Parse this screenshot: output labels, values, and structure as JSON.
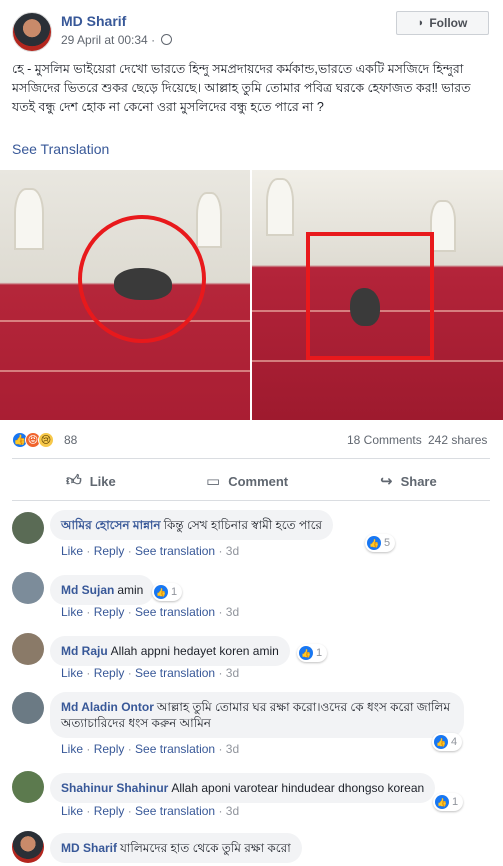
{
  "post": {
    "author": "MD Sharif",
    "timestamp": "29 April at 00:34 · ",
    "follow_label": "Follow",
    "text": "হে - মুসলিম ভাইয়েরা দেখো ভারতে হিন্দু সমপ্রদায়দের কর্মকান্ড,ভারতে একটি মসজিদে হিন্দুরা মসজিদের ভিতরে শুকর ছেড়ে দিয়েছে। আল্লাহ তুমি তোমার পবিত্র ঘরকে হেফাজত কর‼ ভারত যতই বন্ধু দেশ হোক না কেনো ওরা মুসলিদের বন্ধু হতে পারে না ?",
    "see_translation": "See Translation"
  },
  "stats": {
    "reaction_count": "88",
    "comments": "18 Comments",
    "shares": "242 shares"
  },
  "actions": {
    "like": "Like",
    "comment": "Comment",
    "share": "Share"
  },
  "icons": {
    "follow": "rss-icon",
    "like": "thumbs-up-icon",
    "comment": "speech-bubble-icon",
    "share": "share-arrow-icon",
    "privacy": "globe-icon"
  },
  "colors": {
    "link": "#385898",
    "like_blue": "#1877f2",
    "annotation_red": "#e8191c"
  },
  "comments": [
    {
      "name": "আমির হোসেন মান্নান",
      "text": "কিন্তু সেখ হাচিনার স্বামী হতে পারে",
      "like": "Like",
      "reply": "Reply",
      "translation": "See translation",
      "age": "3d",
      "likes": "5"
    },
    {
      "name": "Md Sujan",
      "text": "amin",
      "like": "Like",
      "reply": "Reply",
      "translation": "See translation",
      "age": "3d",
      "likes": "1"
    },
    {
      "name": "Md Raju",
      "text": "Allah appni hedayet koren amin",
      "like": "Like",
      "reply": "Reply",
      "translation": "See translation",
      "age": "3d",
      "likes": "1"
    },
    {
      "name": "Md Aladin Ontor",
      "text": "আল্লাহ তুমি তোমার ঘর রক্ষা করো।ওদের কে ধংস করো জালিম অত্যাচারিদের ধংস করুন আমিন",
      "like": "Like",
      "reply": "Reply",
      "translation": "See translation",
      "age": "3d",
      "likes": "4"
    },
    {
      "name": "Shahinur Shahinur",
      "text": "Allah aponi varotear hindudear dhongso korean",
      "like": "Like",
      "reply": "Reply",
      "translation": "See translation",
      "age": "3d",
      "likes": "1"
    },
    {
      "name": "MD Sharif",
      "text": "যালিমদের হাত থেকে তুমি রক্ষা করো"
    }
  ]
}
